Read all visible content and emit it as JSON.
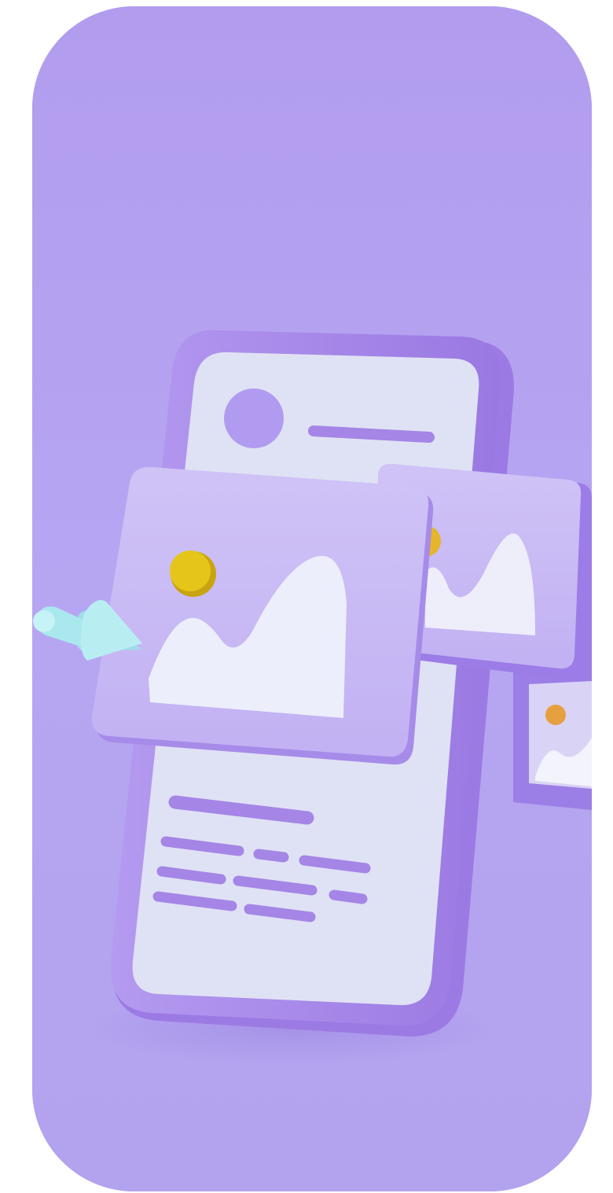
{
  "illustration": {
    "subject": "3d-mobile-app-mockup",
    "icons": [
      "phone-icon",
      "image-placeholder-icon",
      "cursor-arrow-icon",
      "avatar-circle-icon"
    ]
  },
  "colors": {
    "background": "#b6a6f2",
    "phone_frame": "#a98ae9",
    "phone_screen": "#dfe2f4",
    "accent_line": "#a585e6",
    "sun": "#e6c51b",
    "cursor": "#a9e9ee"
  }
}
